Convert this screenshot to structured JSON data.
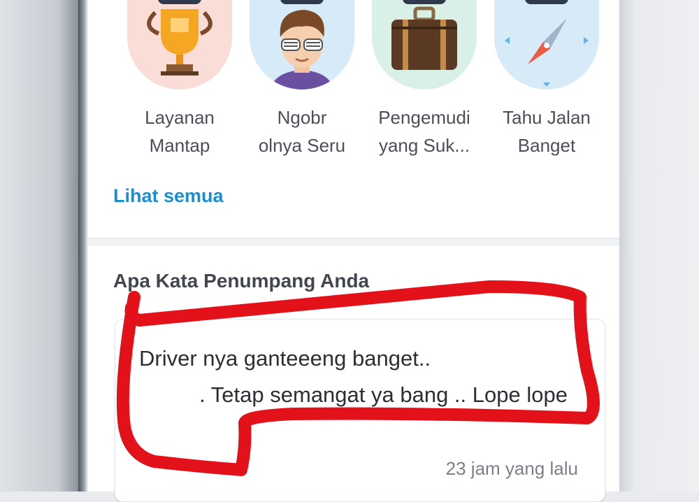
{
  "badges": [
    {
      "label": "Layanan\nMantap",
      "icon": "trophy-icon",
      "bg": "#f9ddd6"
    },
    {
      "label": "Ngobr\nolnya Seru",
      "icon": "cool-guy-icon",
      "bg": "#d6eaf8"
    },
    {
      "label": "Pengemudi\nyang Suk...",
      "icon": "suitcase-icon",
      "bg": "#d8f0e6"
    },
    {
      "label": "Tahu Jalan\nBanget",
      "icon": "compass-icon",
      "bg": "#d6eaf8"
    }
  ],
  "see_all": "Lihat semua",
  "reviews_section": {
    "title": "Apa Kata Penumpang Anda",
    "review": {
      "text": "Driver nya ganteeeng banget..\n          . Tetap semangat ya bang .. Lope lope",
      "time": "23 jam yang lalu"
    }
  },
  "colors": {
    "link": "#1a8fd0",
    "highlight": "#e3111a"
  }
}
